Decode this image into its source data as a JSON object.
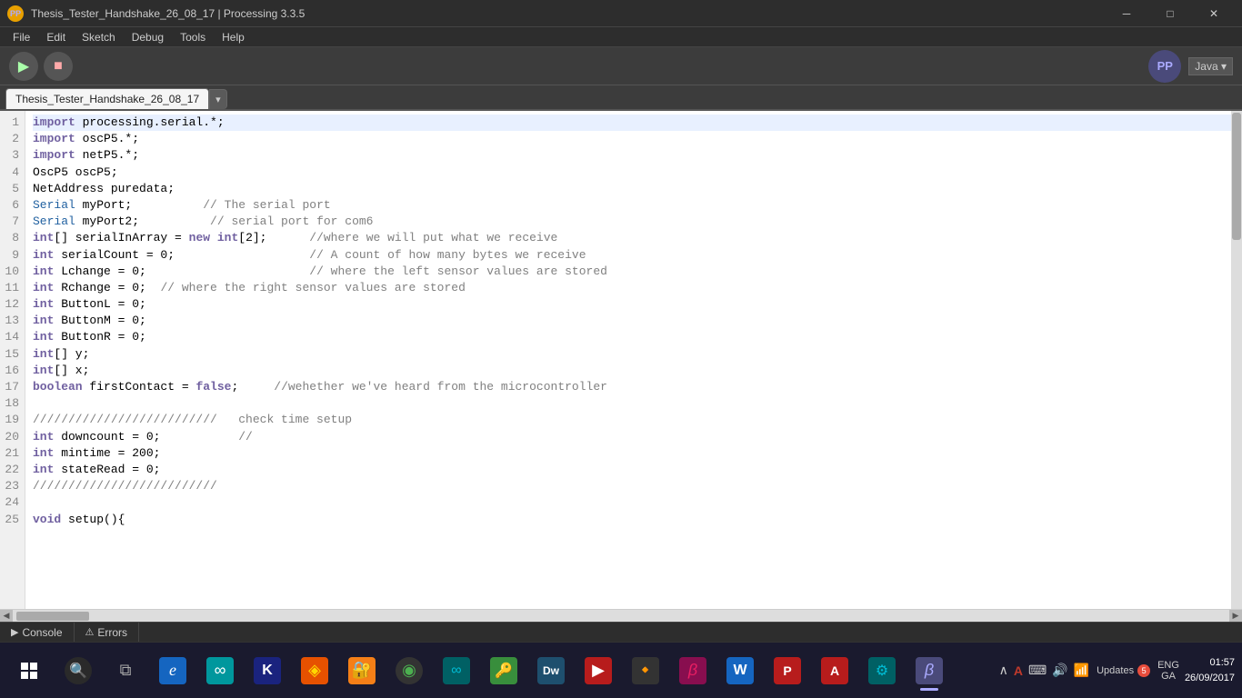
{
  "titlebar": {
    "title": "Thesis_Tester_Handshake_26_08_17 | Processing 3.3.5",
    "app_icon": "P",
    "minimize_label": "─",
    "maximize_label": "□",
    "close_label": "✕"
  },
  "menubar": {
    "items": [
      "File",
      "Edit",
      "Sketch",
      "Debug",
      "Tools",
      "Help"
    ]
  },
  "toolbar": {
    "run_icon": "▶",
    "stop_icon": "■",
    "logo_text": "PP",
    "java_label": "Java ▾"
  },
  "tab": {
    "name": "Thesis_Tester_Handshake_26_08_17",
    "dropdown": "▾"
  },
  "code": {
    "lines": [
      {
        "num": "1",
        "text": "import processing.serial.*;"
      },
      {
        "num": "2",
        "text": "import oscP5.*;"
      },
      {
        "num": "3",
        "text": "import netP5.*;"
      },
      {
        "num": "4",
        "text": "OscP5 oscP5;"
      },
      {
        "num": "5",
        "text": "NetAddress puredata;"
      },
      {
        "num": "6",
        "text": "Serial myPort;          // The serial port"
      },
      {
        "num": "7",
        "text": "Serial myPort2;          // serial port for com6"
      },
      {
        "num": "8",
        "text": "int[] serialInArray = new int[2];      //where we will put what we receive"
      },
      {
        "num": "9",
        "text": "int serialCount = 0;                   // A count of how many bytes we receive"
      },
      {
        "num": "10",
        "text": "int Lchange = 0;                       // where the left sensor values are stored"
      },
      {
        "num": "11",
        "text": "int Rchange = 0;  // where the right sensor values are stored"
      },
      {
        "num": "12",
        "text": "int ButtonL = 0;"
      },
      {
        "num": "13",
        "text": "int ButtonM = 0;"
      },
      {
        "num": "14",
        "text": "int ButtonR = 0;"
      },
      {
        "num": "15",
        "text": "int[] y;"
      },
      {
        "num": "16",
        "text": "int[] x;"
      },
      {
        "num": "17",
        "text": "boolean firstContact = false;     //wehether we've heard from the microcontroller"
      },
      {
        "num": "18",
        "text": ""
      },
      {
        "num": "19",
        "text": "//////////////////////////   check time setup"
      },
      {
        "num": "20",
        "text": "int downcount = 0;           //"
      },
      {
        "num": "21",
        "text": "int mintime = 200;"
      },
      {
        "num": "22",
        "text": "int stateRead = 0;"
      },
      {
        "num": "23",
        "text": "//////////////////////////"
      },
      {
        "num": "24",
        "text": ""
      },
      {
        "num": "25",
        "text": "void setup(){"
      }
    ]
  },
  "bottom_panel": {
    "console_label": "Console",
    "errors_label": "Errors",
    "console_icon": "▶",
    "errors_icon": "⚠"
  },
  "taskbar": {
    "apps": [
      {
        "name": "windows-start",
        "icon": "⊞",
        "color": "#ffffff",
        "active": false
      },
      {
        "name": "search",
        "icon": "🔍",
        "color": "#cccccc",
        "active": false
      },
      {
        "name": "task-view",
        "icon": "⧉",
        "color": "#cccccc",
        "active": false
      },
      {
        "name": "edge",
        "icon": "e",
        "color": "#1da1f2",
        "active": false,
        "bg": "#1565c0"
      },
      {
        "name": "arduino",
        "icon": "⚙",
        "color": "#00979d",
        "active": false,
        "bg": "#00979d"
      },
      {
        "name": "kleopatra",
        "icon": "K",
        "color": "#2196f3",
        "active": false,
        "bg": "#1a237e"
      },
      {
        "name": "app5",
        "icon": "●",
        "color": "#ff9800",
        "active": false,
        "bg": "#e65100"
      },
      {
        "name": "app6",
        "icon": "◈",
        "color": "#ffd600",
        "active": false,
        "bg": "#f57f17"
      },
      {
        "name": "chrome",
        "icon": "◉",
        "color": "#4caf50",
        "active": false,
        "bg": "#333"
      },
      {
        "name": "arduino2",
        "icon": "∞",
        "color": "#00bcd4",
        "active": false,
        "bg": "#006064"
      },
      {
        "name": "keepass",
        "icon": "🔑",
        "color": "#ffffff",
        "active": false,
        "bg": "#388e3c"
      },
      {
        "name": "dreamweaver",
        "icon": "Dw",
        "color": "#ffffff",
        "active": false,
        "bg": "#1e4f6e"
      },
      {
        "name": "app10",
        "icon": "▶",
        "color": "#f44336",
        "active": false,
        "bg": "#b71c1c"
      },
      {
        "name": "vlc",
        "icon": "🔸",
        "color": "#ff9800",
        "active": false,
        "bg": "#333"
      },
      {
        "name": "app12",
        "icon": "β",
        "color": "#e91e63",
        "active": false,
        "bg": "#880e4f"
      },
      {
        "name": "word",
        "icon": "W",
        "color": "#ffffff",
        "active": false,
        "bg": "#1565c0"
      },
      {
        "name": "powerpoint",
        "icon": "P",
        "color": "#ffffff",
        "active": false,
        "bg": "#b71c1c"
      },
      {
        "name": "acrobat",
        "icon": "A",
        "color": "#f44336",
        "active": false,
        "bg": "#b71c1c"
      },
      {
        "name": "arduino3",
        "icon": "⚙",
        "color": "#00bcd4",
        "active": false,
        "bg": "#006064"
      },
      {
        "name": "processing",
        "icon": "β",
        "color": "#ffffff",
        "active": true,
        "bg": "#4a4a7a"
      }
    ],
    "tray": {
      "show_hidden_icon": "∧",
      "antivirus_icon": "A",
      "keyboard_icon": "⌨",
      "sound_icon": "🔊",
      "network_icon": "📶",
      "language": "ENG\nGA",
      "time": "01:57",
      "date": "26/09/2017",
      "notification_label": "Updates",
      "notification_count": "5"
    }
  }
}
